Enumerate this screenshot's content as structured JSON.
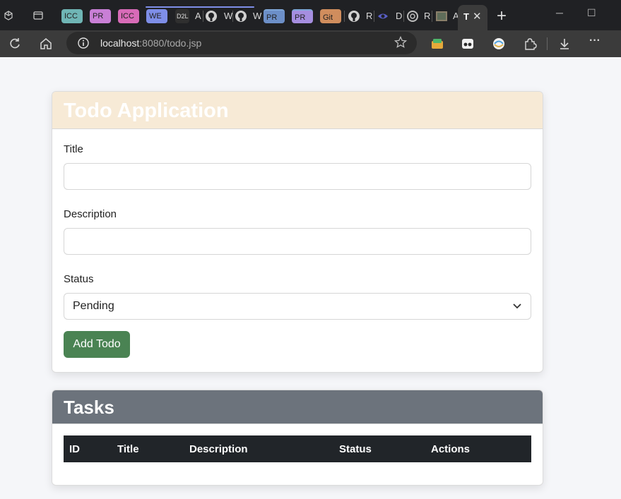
{
  "browser": {
    "tabs": [
      {
        "label": "ICC",
        "color": "#6fb5b5"
      },
      {
        "label": "PR",
        "color": "#c97fd6"
      },
      {
        "label": "ICC",
        "color": "#d86bb8"
      },
      {
        "label": "WE",
        "color": "#7e8ee8"
      },
      {
        "label": "D2L",
        "color": "#2f2f2f"
      },
      {
        "label": "A"
      },
      {
        "label": "W"
      },
      {
        "label": "W"
      },
      {
        "label": "PR",
        "color": "#6c8fc8"
      },
      {
        "label": "PR",
        "color": "#a58ee0"
      },
      {
        "label": "Git",
        "color": "#d08d5d"
      },
      {
        "label": "R"
      },
      {
        "label": "D"
      },
      {
        "label": "R"
      },
      {
        "label": "A"
      }
    ],
    "active_tab": {
      "favicon_letter": "T",
      "close": "✕"
    },
    "new_tab": "+",
    "window_minimize": "─",
    "window_maximize": "☐",
    "url_host": "localhost",
    "url_rest": ":8080/todo.jsp",
    "more_menu": "···"
  },
  "page": {
    "form_card": {
      "title": "Todo Application",
      "title_label": "Title",
      "title_value": "",
      "description_label": "Description",
      "description_value": "",
      "status_label": "Status",
      "status_selected": "Pending",
      "submit_label": "Add Todo"
    },
    "tasks_card": {
      "title": "Tasks",
      "columns": [
        "ID",
        "Title",
        "Description",
        "Status",
        "Actions"
      ]
    }
  },
  "colors": {
    "form_header_bg": "#f7ead6",
    "tasks_header_bg": "#6c737c",
    "table_header_bg": "#212529",
    "add_button_bg": "#4a8353"
  }
}
